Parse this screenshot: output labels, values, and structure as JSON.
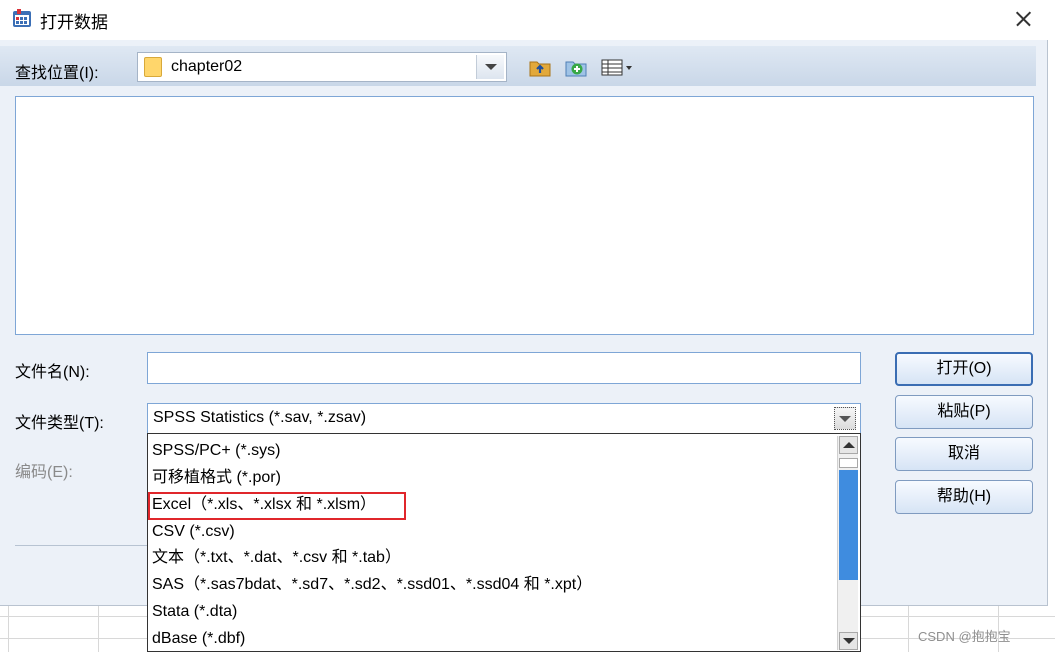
{
  "window": {
    "title": "打开数据",
    "close_icon": "close-icon"
  },
  "look_in": {
    "label": "查找位置(I):",
    "value": "chapter02"
  },
  "file_name": {
    "label": "文件名(N):",
    "value": ""
  },
  "file_type": {
    "label": "文件类型(T):",
    "value": "SPSS Statistics (*.sav, *.zsav)",
    "options": [
      "SPSS/PC+ (*.sys)",
      "可移植格式 (*.por)",
      "Excel（*.xls、*.xlsx 和 *.xlsm）",
      "CSV (*.csv)",
      "文本（*.txt、*.dat、*.csv 和 *.tab）",
      "SAS（*.sas7bdat、*.sd7、*.sd2、*.ssd01、*.ssd04 和 *.xpt）",
      "Stata (*.dta)",
      "dBase (*.dbf)"
    ],
    "highlighted_option_index": 2,
    "highlight_color": "#e0262b"
  },
  "encoding": {
    "label": "编码(E):"
  },
  "buttons": {
    "open": "打开(O)",
    "paste": "粘贴(P)",
    "cancel": "取消",
    "help": "帮助(H)"
  },
  "watermark": "CSDN @抱抱宝",
  "colors": {
    "dialog_bg": "#ecf1f8",
    "accent_border": "#7ea6d6",
    "scroll_thumb": "#3f8cdf"
  }
}
